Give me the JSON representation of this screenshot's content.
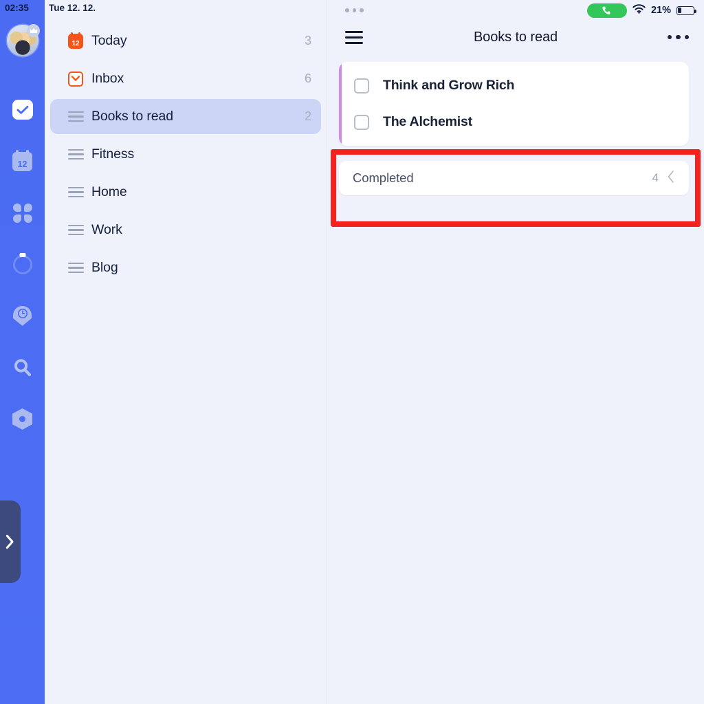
{
  "statusbar_left": {
    "time": "02:35",
    "date": "Tue 12. 12."
  },
  "statusbar_right": {
    "call_icon": "phone-call-icon",
    "wifi_icon": "wifi-icon",
    "battery_percent": "21%",
    "battery_icon": "battery-low-icon",
    "overflow_icon": "three-dots-icon"
  },
  "rail": {
    "avatar": "user-avatar",
    "crown_badge": "crown-icon",
    "items": [
      {
        "icon": "check-square-icon",
        "label": "Tasks",
        "active": true
      },
      {
        "icon": "calendar-12-icon",
        "label": "Calendar",
        "active": false
      },
      {
        "icon": "clover-grid-icon",
        "label": "Widgets",
        "active": false
      },
      {
        "icon": "progress-ring-icon",
        "label": "Focus",
        "active": false
      },
      {
        "icon": "clock-badge-icon",
        "label": "History",
        "active": false
      },
      {
        "icon": "search-icon",
        "label": "Search",
        "active": false
      },
      {
        "icon": "hex-settings-icon",
        "label": "Settings",
        "active": false
      }
    ],
    "drawer_tab_icon": "chevron-right-icon"
  },
  "lists": {
    "items": [
      {
        "icon": "calendar-today-icon",
        "label": "Today",
        "count": "3",
        "selected": false
      },
      {
        "icon": "inbox-icon",
        "label": "Inbox",
        "count": "6",
        "selected": false
      },
      {
        "icon": "list-lines-icon",
        "label": "Books to read",
        "count": "2",
        "selected": true
      },
      {
        "icon": "list-lines-icon",
        "label": "Fitness",
        "count": "",
        "selected": false
      },
      {
        "icon": "list-lines-icon",
        "label": "Home",
        "count": "",
        "selected": false
      },
      {
        "icon": "list-lines-icon",
        "label": "Work",
        "count": "",
        "selected": false
      },
      {
        "icon": "list-lines-icon",
        "label": "Blog",
        "count": "",
        "selected": false
      }
    ]
  },
  "task_panel": {
    "menu_icon": "hamburger-menu-icon",
    "title": "Books to read",
    "more_icon": "three-dots-icon",
    "accent_color": "#d08ae8",
    "tasks": [
      {
        "label": "Think and Grow Rich",
        "checked": false
      },
      {
        "label": "The Alchemist",
        "checked": false
      }
    ],
    "completed": {
      "label": "Completed",
      "count": "4",
      "chevron_icon": "chevron-left-icon"
    }
  },
  "annotation": {
    "highlight_color": "#f4231f",
    "target": "completed-section"
  }
}
